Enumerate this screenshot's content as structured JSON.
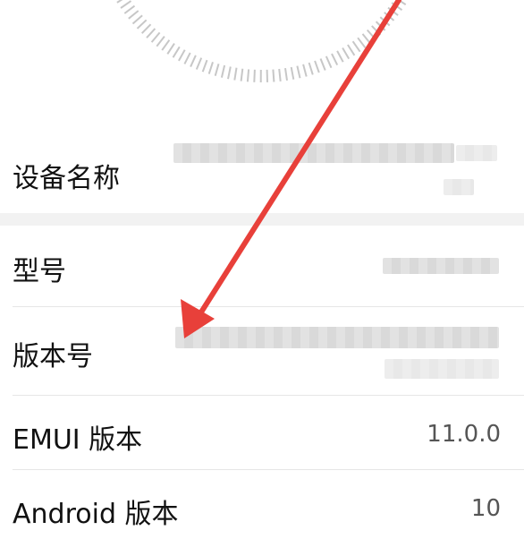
{
  "rows": [
    {
      "label": "设备名称",
      "value": ""
    },
    {
      "label": "型号",
      "value": ""
    },
    {
      "label": "版本号",
      "value": ""
    },
    {
      "label": "EMUI 版本",
      "value": "11.0.0"
    },
    {
      "label": "Android 版本",
      "value": "10"
    }
  ],
  "colors": {
    "arrow": "#e8403a",
    "divider": "#e6e6e6",
    "section_gap": "#f2f2f2"
  }
}
